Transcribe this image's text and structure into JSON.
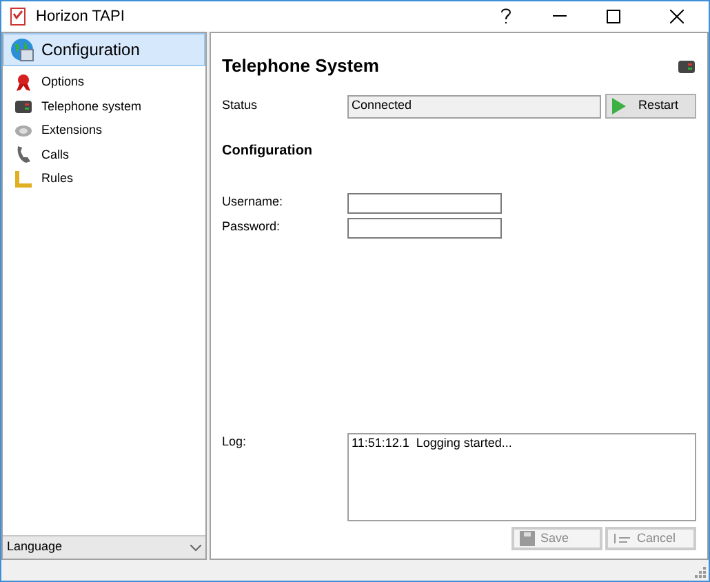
{
  "window": {
    "title": "Horizon TAPI"
  },
  "sidebar": {
    "header": {
      "label": "Configuration",
      "selected": true
    },
    "items": [
      {
        "label": "Options",
        "kind": "ribbon",
        "selected": false
      },
      {
        "label": "Telephone system",
        "kind": "server",
        "selected": false
      },
      {
        "label": "Extensions",
        "kind": "ext",
        "selected": false
      },
      {
        "label": "Calls",
        "kind": "phone",
        "selected": false
      },
      {
        "label": "Rules",
        "kind": "rule",
        "selected": false
      }
    ],
    "language": {
      "value": "Language"
    }
  },
  "panel": {
    "title": "Telephone System",
    "status_label": "Status",
    "status_value": "Connected",
    "restart": "Restart",
    "section": "Configuration",
    "fields": [
      {
        "label": "Username:"
      },
      {
        "label": "Password:"
      }
    ],
    "log_label": "Log:",
    "log_lines": [
      "11:51:12.1  Logging started..."
    ],
    "buttons": [
      {
        "label": "Save",
        "kind": "save",
        "disabled": true
      },
      {
        "label": "Cancel",
        "kind": "cancel",
        "disabled": true
      }
    ]
  }
}
